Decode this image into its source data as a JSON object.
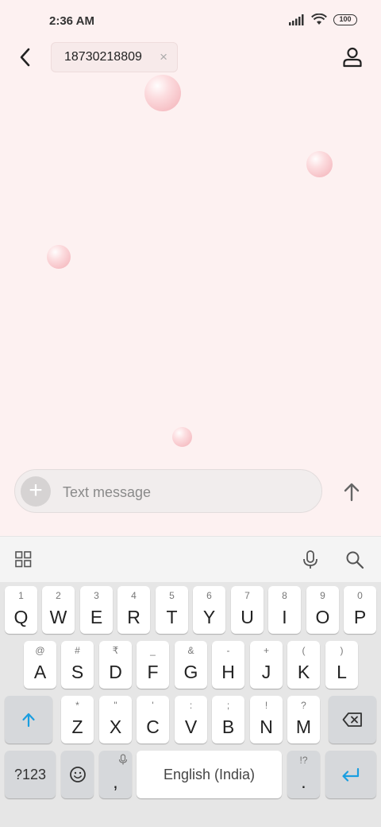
{
  "status_bar": {
    "time": "2:36 AM",
    "battery": "100"
  },
  "conversation": {
    "recipient": "18730218809",
    "remove_symbol": "×"
  },
  "composer": {
    "placeholder": "Text message",
    "attach_symbol": "+"
  },
  "keyboard": {
    "row1": [
      {
        "hint": "1",
        "label": "Q"
      },
      {
        "hint": "2",
        "label": "W"
      },
      {
        "hint": "3",
        "label": "E"
      },
      {
        "hint": "4",
        "label": "R"
      },
      {
        "hint": "5",
        "label": "T"
      },
      {
        "hint": "6",
        "label": "Y"
      },
      {
        "hint": "7",
        "label": "U"
      },
      {
        "hint": "8",
        "label": "I"
      },
      {
        "hint": "9",
        "label": "O"
      },
      {
        "hint": "0",
        "label": "P"
      }
    ],
    "row2": [
      {
        "hint": "@",
        "label": "A"
      },
      {
        "hint": "#",
        "label": "S"
      },
      {
        "hint": "₹",
        "label": "D"
      },
      {
        "hint": "_",
        "label": "F"
      },
      {
        "hint": "&",
        "label": "G"
      },
      {
        "hint": "-",
        "label": "H"
      },
      {
        "hint": "+",
        "label": "J"
      },
      {
        "hint": "(",
        "label": "K"
      },
      {
        "hint": ")",
        "label": "L"
      }
    ],
    "row3": [
      {
        "hint": "*",
        "label": "Z"
      },
      {
        "hint": "\"",
        "label": "X"
      },
      {
        "hint": "'",
        "label": "C"
      },
      {
        "hint": ":",
        "label": "V"
      },
      {
        "hint": ";",
        "label": "B"
      },
      {
        "hint": "!",
        "label": "N"
      },
      {
        "hint": "?",
        "label": "M"
      }
    ],
    "symbols_label": "?123",
    "comma_label": ",",
    "space_label": "English (India)",
    "period_label": ".",
    "period_hint": "!?"
  },
  "icons": {
    "back": "chevron-left-icon",
    "contact": "person-icon",
    "send": "arrow-up-icon",
    "grid": "grid-icon",
    "mic": "mic-icon",
    "search": "search-icon",
    "shift": "shift-icon",
    "backspace": "backspace-icon",
    "emoji": "emoji-icon",
    "enter": "enter-icon"
  },
  "colors": {
    "background": "#fdf1f1",
    "accent": "#1a9ee0",
    "key": "#ffffff",
    "function_key": "#d6d8db"
  }
}
